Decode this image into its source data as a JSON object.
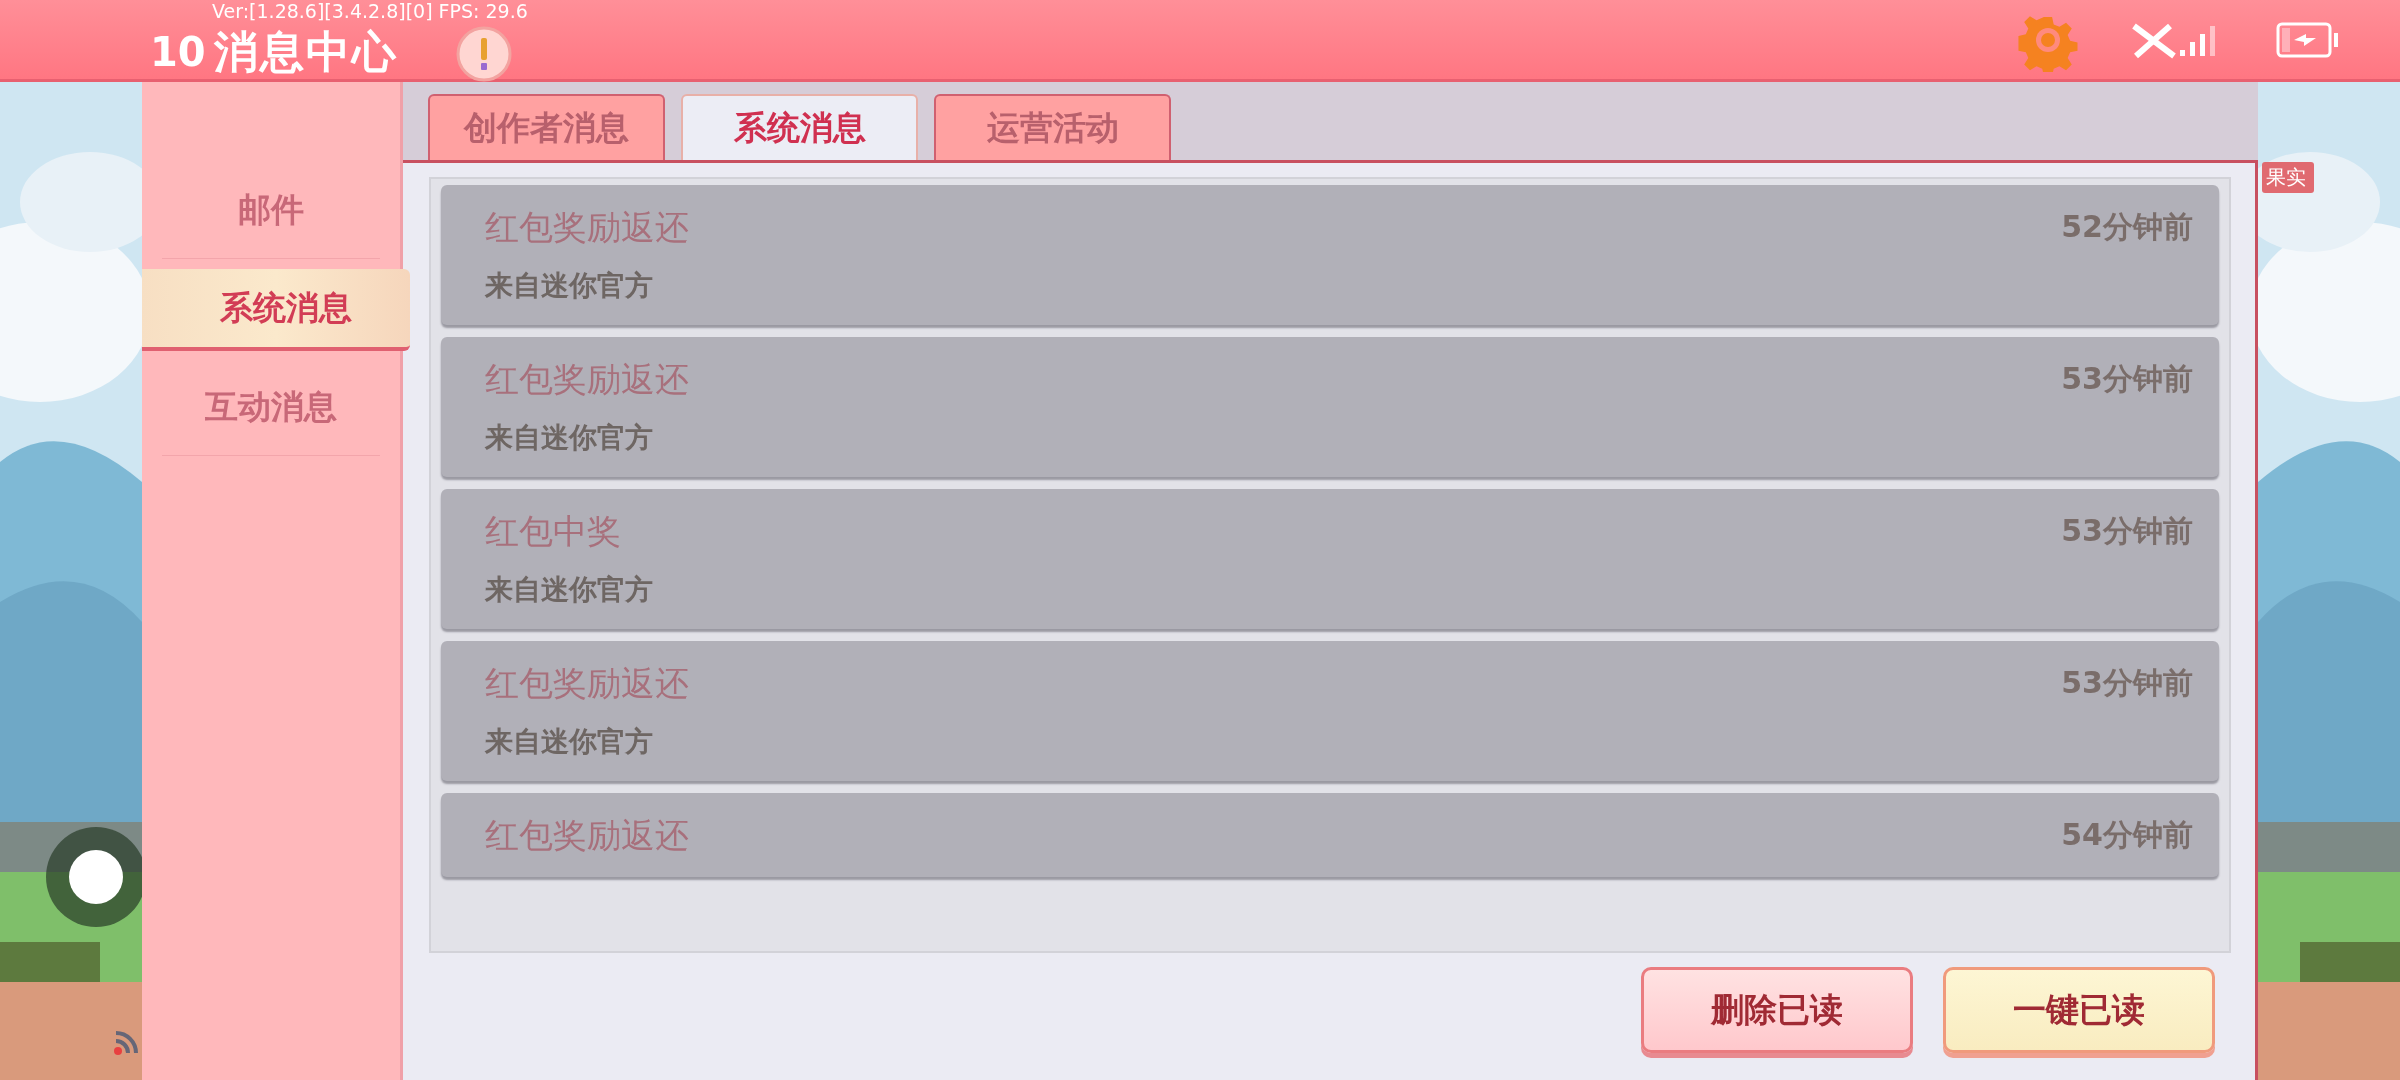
{
  "top_bar": {
    "debug": "Ver:[1.28.6][3.4.2.8][0] FPS: 29.6",
    "badge": "10",
    "title": "消息中心"
  },
  "sidebar": {
    "items": [
      {
        "label": "邮件",
        "selected": false
      },
      {
        "label": "系统消息",
        "selected": true
      },
      {
        "label": "互动消息",
        "selected": false
      }
    ]
  },
  "tabs": [
    {
      "label": "创作者消息",
      "selected": false
    },
    {
      "label": "系统消息",
      "selected": true
    },
    {
      "label": "运营活动",
      "selected": false
    }
  ],
  "messages": [
    {
      "title": "红包奖励返还",
      "source": "来自迷你官方",
      "time": "52分钟前"
    },
    {
      "title": "红包奖励返还",
      "source": "来自迷你官方",
      "time": "53分钟前"
    },
    {
      "title": "红包中奖",
      "source": "来自迷你官方",
      "time": "53分钟前"
    },
    {
      "title": "红包奖励返还",
      "source": "来自迷你官方",
      "time": "53分钟前"
    },
    {
      "title": "红包奖励返还",
      "time": "54分钟前"
    }
  ],
  "buttons": [
    {
      "label": "删除已读",
      "kind": "delete"
    },
    {
      "label": "一键已读",
      "kind": "read"
    }
  ],
  "scene_label": "果实"
}
